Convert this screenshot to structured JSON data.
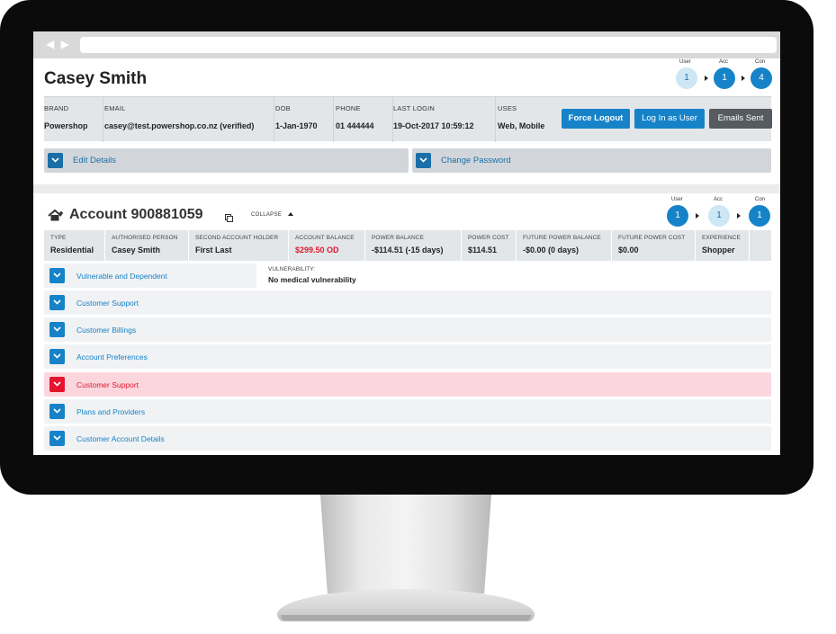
{
  "user": {
    "name": "Casey Smith",
    "steps": [
      {
        "label": "User",
        "value": "1",
        "state": "light"
      },
      {
        "label": "Acc",
        "value": "1",
        "state": "dark"
      },
      {
        "label": "Con",
        "value": "4",
        "state": "dark"
      }
    ],
    "info": [
      {
        "label": "BRAND",
        "value": "Powershop"
      },
      {
        "label": "EMAIL",
        "value": "casey@test.powershop.co.nz (verified)"
      },
      {
        "label": "DOB",
        "value": "1-Jan-1970"
      },
      {
        "label": "PHONE",
        "value": "01 444444"
      },
      {
        "label": "LAST LOGIN",
        "value": "19-Oct-2017 10:59:12"
      },
      {
        "label": "USES",
        "value": "Web, Mobile"
      }
    ],
    "buttons": {
      "force_logout": "Force Logout",
      "log_in_as_user": "Log In as User",
      "emails_sent": "Emails Sent"
    },
    "expanders": {
      "edit_details": "Edit Details",
      "change_password": "Change Password"
    }
  },
  "account": {
    "title": "Account 900881059",
    "collapse_label": "COLLAPSE",
    "steps": [
      {
        "label": "User",
        "value": "1",
        "state": "dark"
      },
      {
        "label": "Acc",
        "value": "1",
        "state": "light"
      },
      {
        "label": "Con",
        "value": "1",
        "state": "dark"
      }
    ],
    "fields": [
      {
        "label": "TYPE",
        "value": "Residential"
      },
      {
        "label": "AUTHORISED PERSON",
        "value": "Casey Smith"
      },
      {
        "label": "SECOND ACCOUNT HOLDER",
        "value": "First Last"
      },
      {
        "label": "ACCOUNT BALANCE",
        "value": "$299.50 OD"
      },
      {
        "label": "POWER BALANCE",
        "value": "-$114.51 (-15 days)"
      },
      {
        "label": "POWER COST",
        "value": "$114.51"
      },
      {
        "label": "FUTURE POWER BALANCE",
        "value": "-$0.00 (0 days)"
      },
      {
        "label": "FUTURE POWER COST",
        "value": "$0.00"
      },
      {
        "label": "EXPERIENCE",
        "value": "Shopper"
      }
    ],
    "sections": [
      {
        "label": "Vulnerable and Dependent",
        "alert": false
      },
      {
        "label": "Customer Support",
        "alert": false
      },
      {
        "label": "Customer Billings",
        "alert": false
      },
      {
        "label": "Account Preferences",
        "alert": false
      },
      {
        "label": "Customer Support",
        "alert": true
      },
      {
        "label": "Plans and Providers",
        "alert": false
      },
      {
        "label": "Customer Account Details",
        "alert": false
      }
    ],
    "vulnerability": {
      "label": "VULNERABILITY:",
      "value": "No medical vulnerability"
    }
  },
  "colors": {
    "primary": "#1683c8",
    "alert": "#e5142d",
    "alert_row": "#fcd6de",
    "step_light": "#cde7f5",
    "step_dark": "#1683c8"
  }
}
